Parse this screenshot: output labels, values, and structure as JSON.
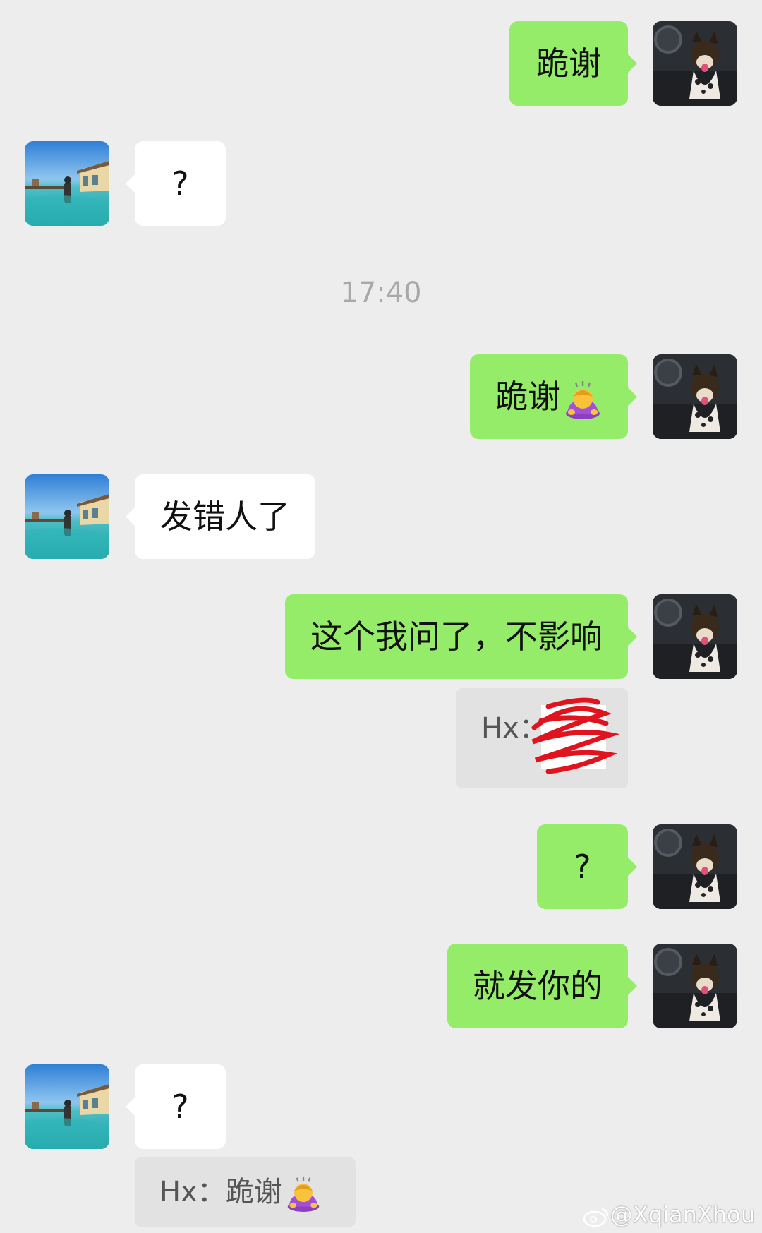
{
  "time_divider": "17:40",
  "messages": [
    {
      "text": "跪谢"
    },
    {
      "text": "?"
    },
    {
      "text": "跪谢"
    },
    {
      "text": "发错人了"
    },
    {
      "text": "这个我问了，不影响"
    },
    {
      "text": "?"
    },
    {
      "text": "就发你的"
    },
    {
      "text": "?"
    }
  ],
  "quotes": [
    {
      "sender": "Hx："
    },
    {
      "sender": "Hx：",
      "text": "跪谢"
    }
  ],
  "watermark": "@XqianXhou",
  "icons": {
    "bow": "person-bowing-emoji",
    "weibo": "weibo-logo"
  },
  "colors": {
    "background": "#ededed",
    "sent_bubble": "#95ec69",
    "received_bubble": "#ffffff",
    "redaction": "#e0141e"
  }
}
